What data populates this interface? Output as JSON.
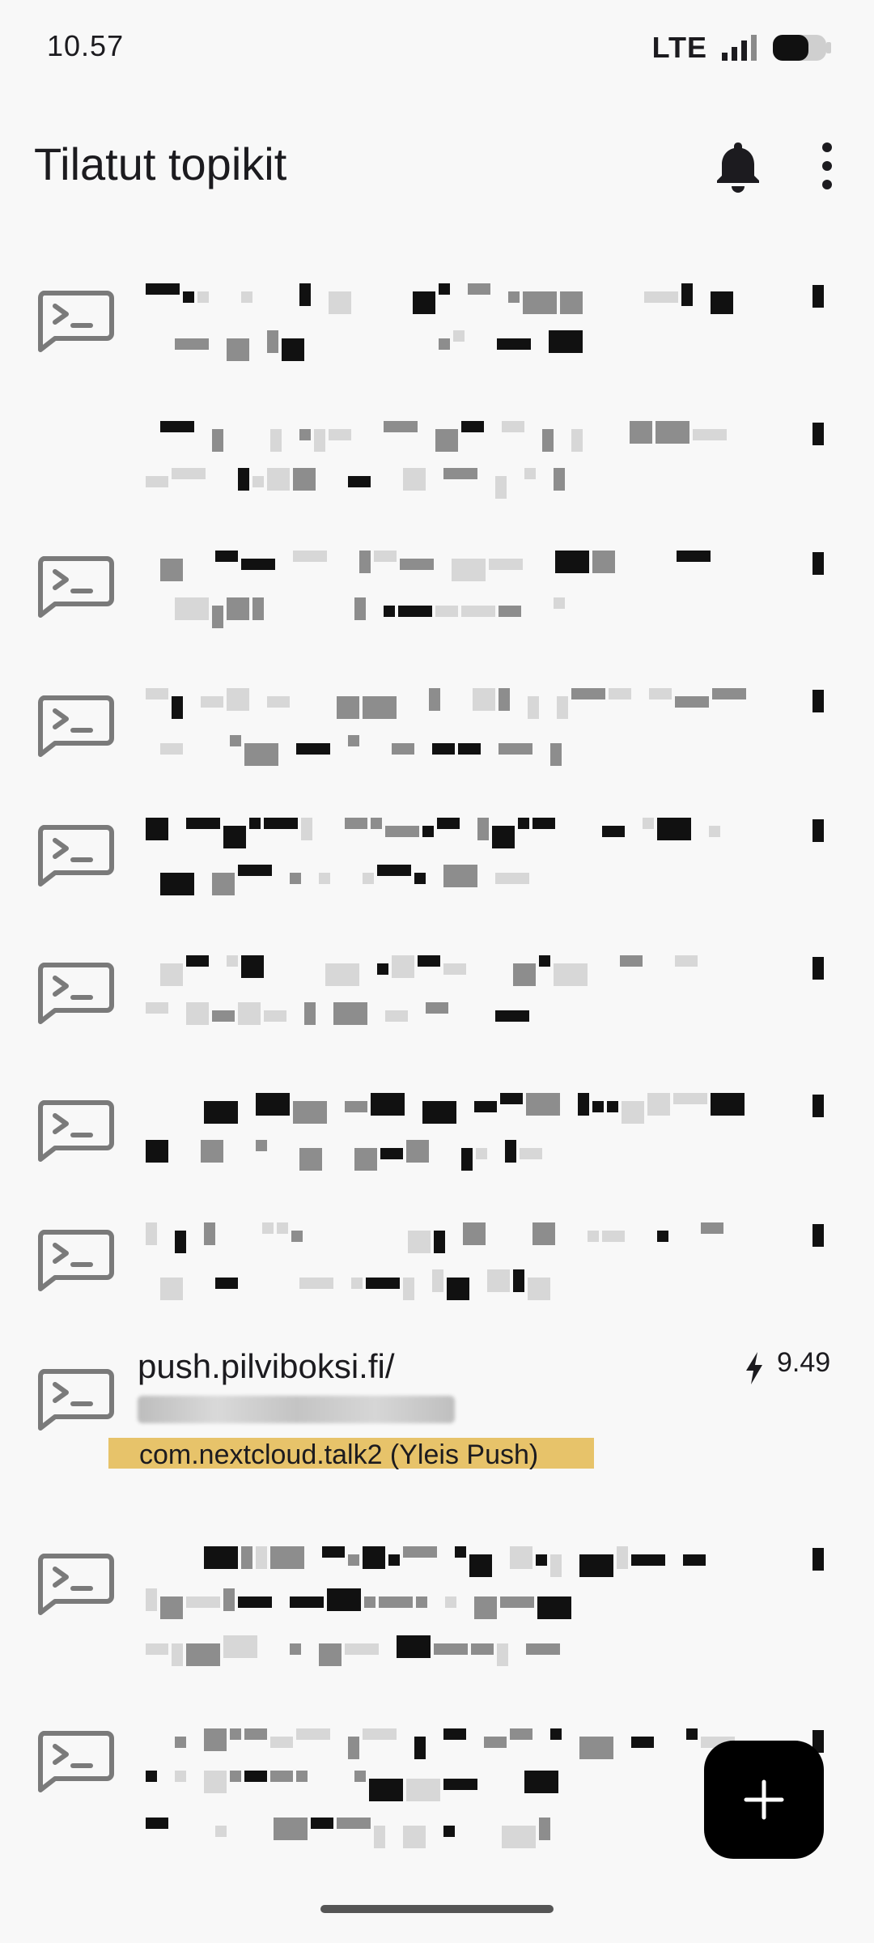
{
  "status_bar": {
    "time": "10.57",
    "network": "LTE"
  },
  "app_bar": {
    "title": "Tilatut topikit"
  },
  "icons": {
    "bell": "bell-icon",
    "more": "more-vert-icon",
    "topic": "terminal-icon",
    "bolt": "bolt-icon",
    "add": "add-icon"
  },
  "topics": [
    {
      "redacted": true
    },
    {
      "redacted": true
    },
    {
      "redacted": true
    },
    {
      "redacted": true
    },
    {
      "redacted": true
    },
    {
      "redacted": true
    },
    {
      "redacted": true
    },
    {
      "redacted": true
    },
    {
      "name": "push.pilviboksi.fi/",
      "last_notification_time": "9.49",
      "app_label": "com.nextcloud.talk2 (Yleis Push)",
      "redacted_line": true
    },
    {
      "redacted": true
    },
    {
      "redacted": true
    }
  ],
  "fab": {
    "label": "+"
  }
}
